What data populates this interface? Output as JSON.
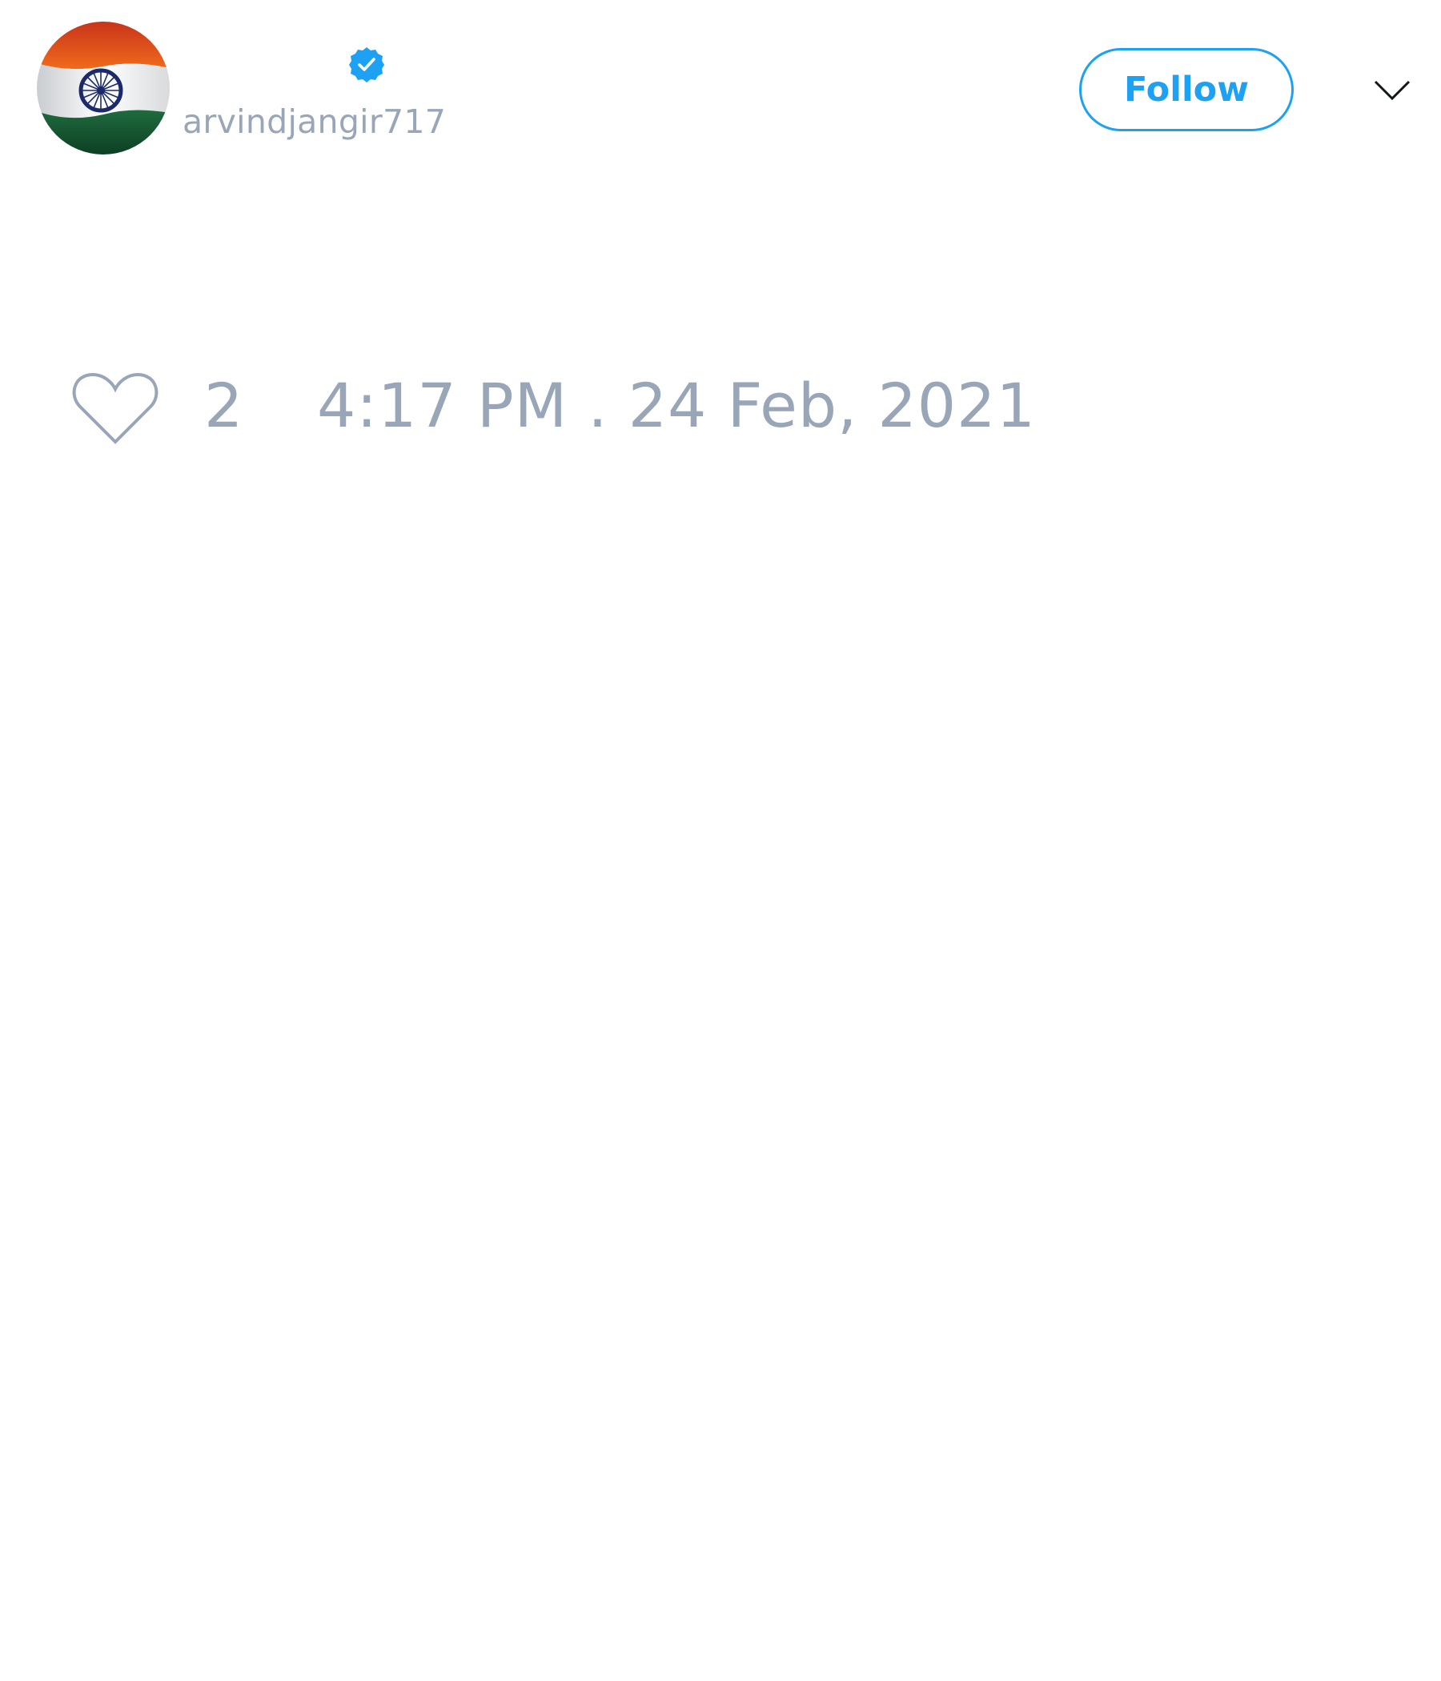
{
  "author": {
    "display_name": "",
    "handle": "arvindjangir717",
    "verified": true,
    "avatar_icon": "india-flag-avatar"
  },
  "actions": {
    "follow_label": "Follow",
    "menu_icon": "chevron-down-icon"
  },
  "tweet": {
    "text": ""
  },
  "stats": {
    "like_icon": "heart-outline-icon",
    "like_count": "2",
    "timestamp": "4:17 PM . 24 Feb, 2021"
  },
  "colors": {
    "accent": "#1da1f2",
    "muted_text": "#99a6b8",
    "background": "#ffffff"
  }
}
